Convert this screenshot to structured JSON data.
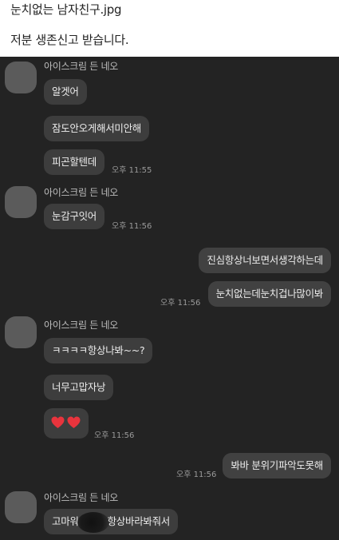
{
  "post": {
    "title": "눈치없는 남자친구.jpg",
    "subtitle": "저분 생존신고 받습니다."
  },
  "chat": {
    "sender_name": "아이스크림 든 네오",
    "messages": {
      "m1": "알겟어",
      "m2": "잠도안오게해서미안해",
      "m3": "피곤할텐데",
      "m3_time": "오후 11:55",
      "m4": "눈감구잇어",
      "m4_time": "오후 11:56",
      "m5": "진심항상너보면서생각하는데",
      "m6": "눈치없는데눈치겁나많이봐",
      "m6_time": "오후 11:56",
      "m7": "ㅋㅋㅋㅋ항상나봐~~?",
      "m8": "너무고맙자낭",
      "m9_time": "오후 11:56",
      "m10": "봐바 분위기파악도못해",
      "m10_time": "오후 11:56",
      "m11_pre": "고마워",
      "m11_post": "항상바라봐줘서"
    },
    "colors": {
      "background": "#232323",
      "bubble": "#3d3d3d",
      "heart": "#e8343d"
    }
  }
}
